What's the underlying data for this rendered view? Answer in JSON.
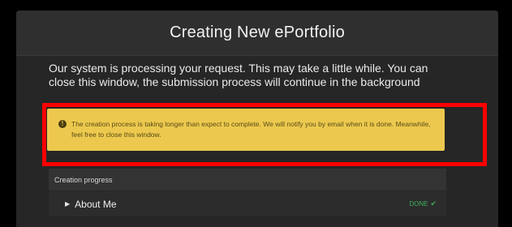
{
  "dialog": {
    "title": "Creating New ePortfolio",
    "message": "Our system is processing your request. This may take a little while. You can close this window, the submission process will continue in the background"
  },
  "alert": {
    "icon": "info-icon",
    "text": "The creation process is taking longer than expect to complete. We will notify you by email when it is done. Meanwhile, feel free to close this window.",
    "color": "#ecc94e"
  },
  "highlight_color": "#ff0000",
  "progress": {
    "header": "Creation progress",
    "items": [
      {
        "label": "About Me",
        "status": "DONE",
        "status_color": "#3fae5a"
      }
    ]
  }
}
